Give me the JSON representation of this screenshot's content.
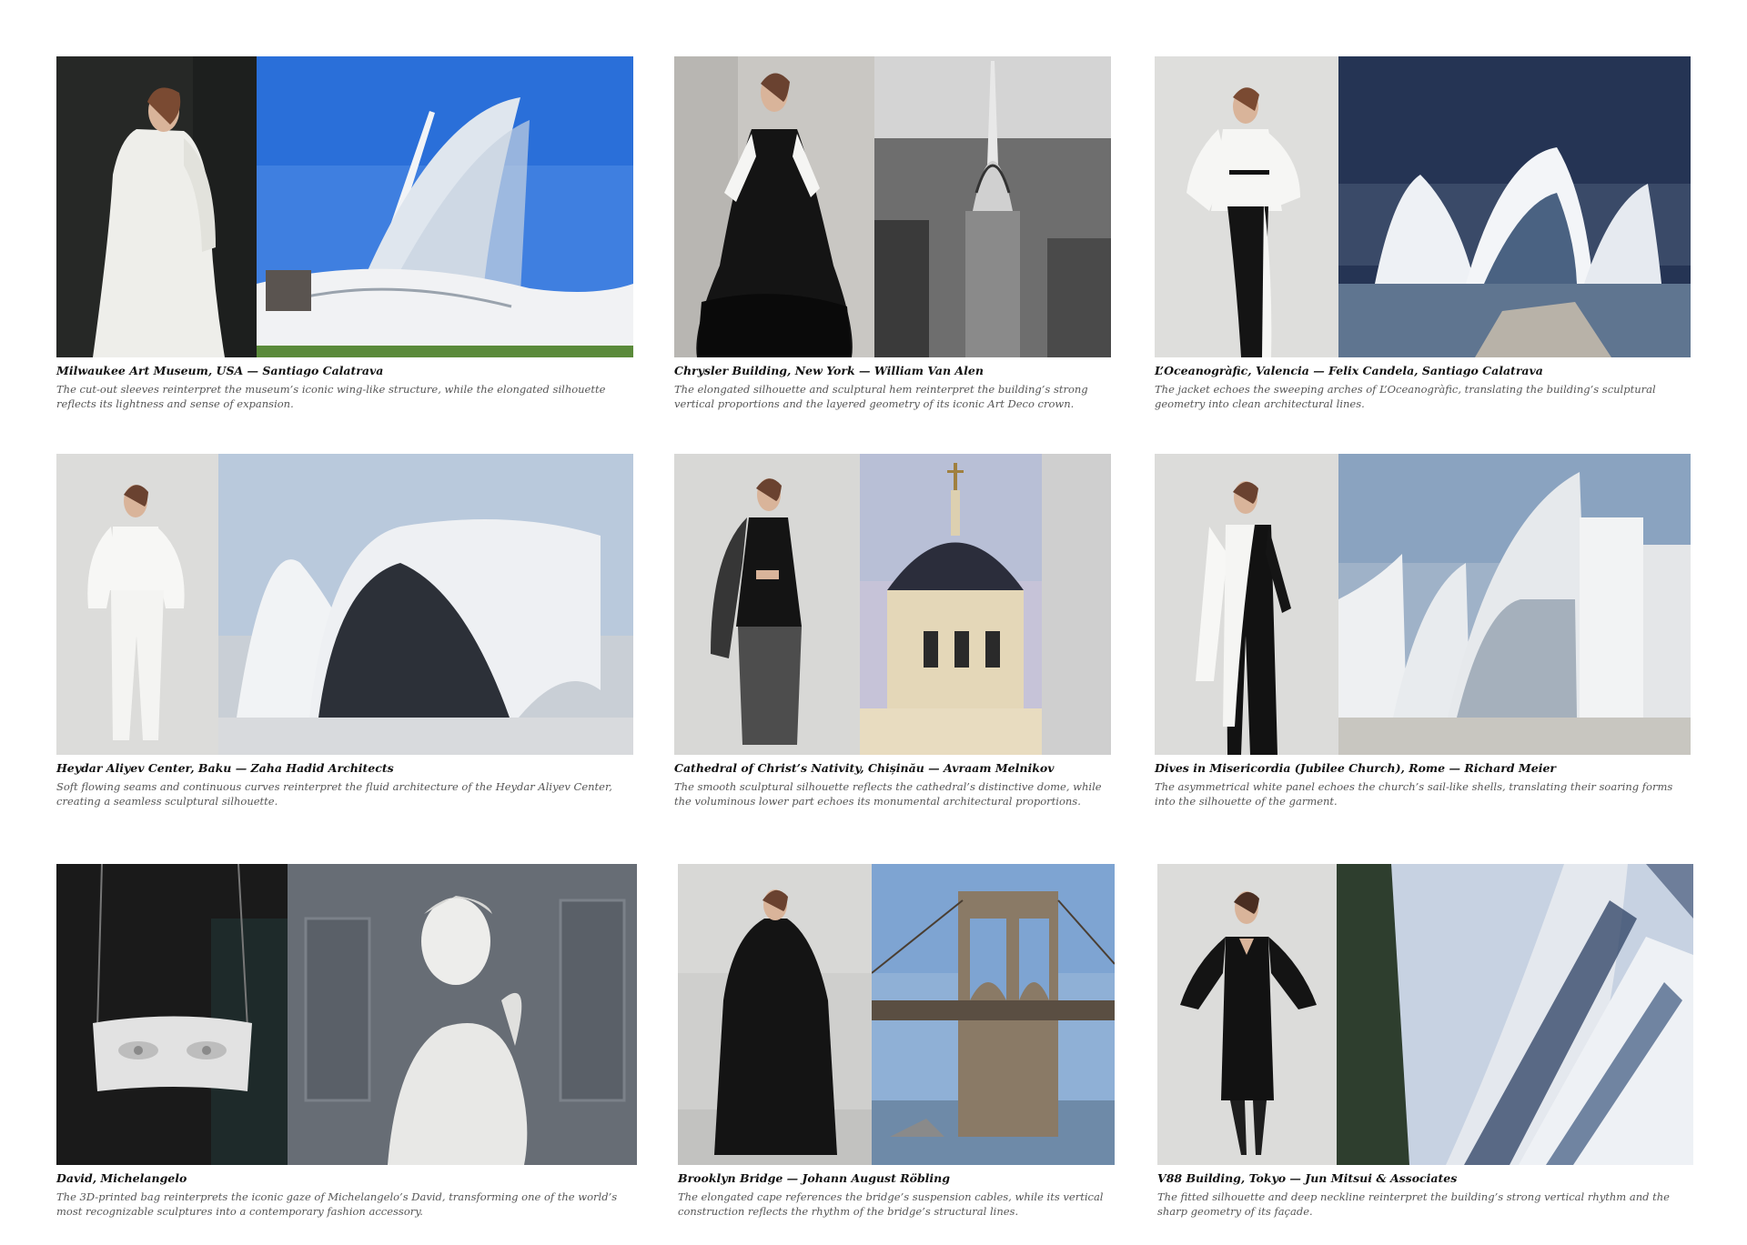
{
  "cards": [
    {
      "title": "Milwaukee Art Museum, USA — Santiago Calatrava",
      "description": "The cut-out sleeves reinterpret the museum’s iconic wing-like structure, while the elongated silhouette reflects its lightness and sense of expansion."
    },
    {
      "title": "Chrysler Building, New York — William Van Alen",
      "description": "The elongated silhouette and sculptural hem reinterpret the building’s strong vertical proportions and the layered geometry of its iconic Art Deco crown."
    },
    {
      "title": "L’Oceanogràfic, Valencia — Felix Candela, Santiago Calatrava",
      "description": "The jacket echoes the sweeping arches of L’Oceanogràfic, translating the building’s sculptural geometry into clean architectural lines."
    },
    {
      "title": "Heydar Aliyev Center, Baku — Zaha Hadid Architects",
      "description": "Soft flowing seams and continuous curves reinterpret the fluid architecture of the Heydar Aliyev Center, creating a seamless sculptural silhouette."
    },
    {
      "title": "Cathedral of Christ’s Nativity, Chișinău — Avraam Melnikov",
      "description": "The smooth sculptural silhouette reflects the cathedral’s distinctive dome, while the voluminous lower part echoes its monumental architectural proportions."
    },
    {
      "title": "Dives in Misericordia (Jubilee Church), Rome — Richard Meier",
      "description": "The asymmetrical white panel echoes the church’s sail-like shells, translating their soaring forms into the silhouette of the garment."
    },
    {
      "title": "David, Michelangelo",
      "description": "The 3D-printed bag reinterprets the iconic gaze of Michelangelo’s David, transforming one of the world’s most recognizable sculptures into a contemporary fashion accessory."
    },
    {
      "title": "Brooklyn Bridge — Johann August Röbling",
      "description": "The elongated cape references the bridge’s suspension cables, while its vertical construction reflects the rhythm of the bridge’s structural lines."
    },
    {
      "title": "V88 Building, Tokyo — Jun Mitsui & Associates",
      "description": "The fitted silhouette and deep neckline reinterpret the building’s strong vertical rhythm and the sharp geometry of its façade."
    }
  ],
  "colors": {
    "title": "#111111",
    "description": "#555555"
  }
}
